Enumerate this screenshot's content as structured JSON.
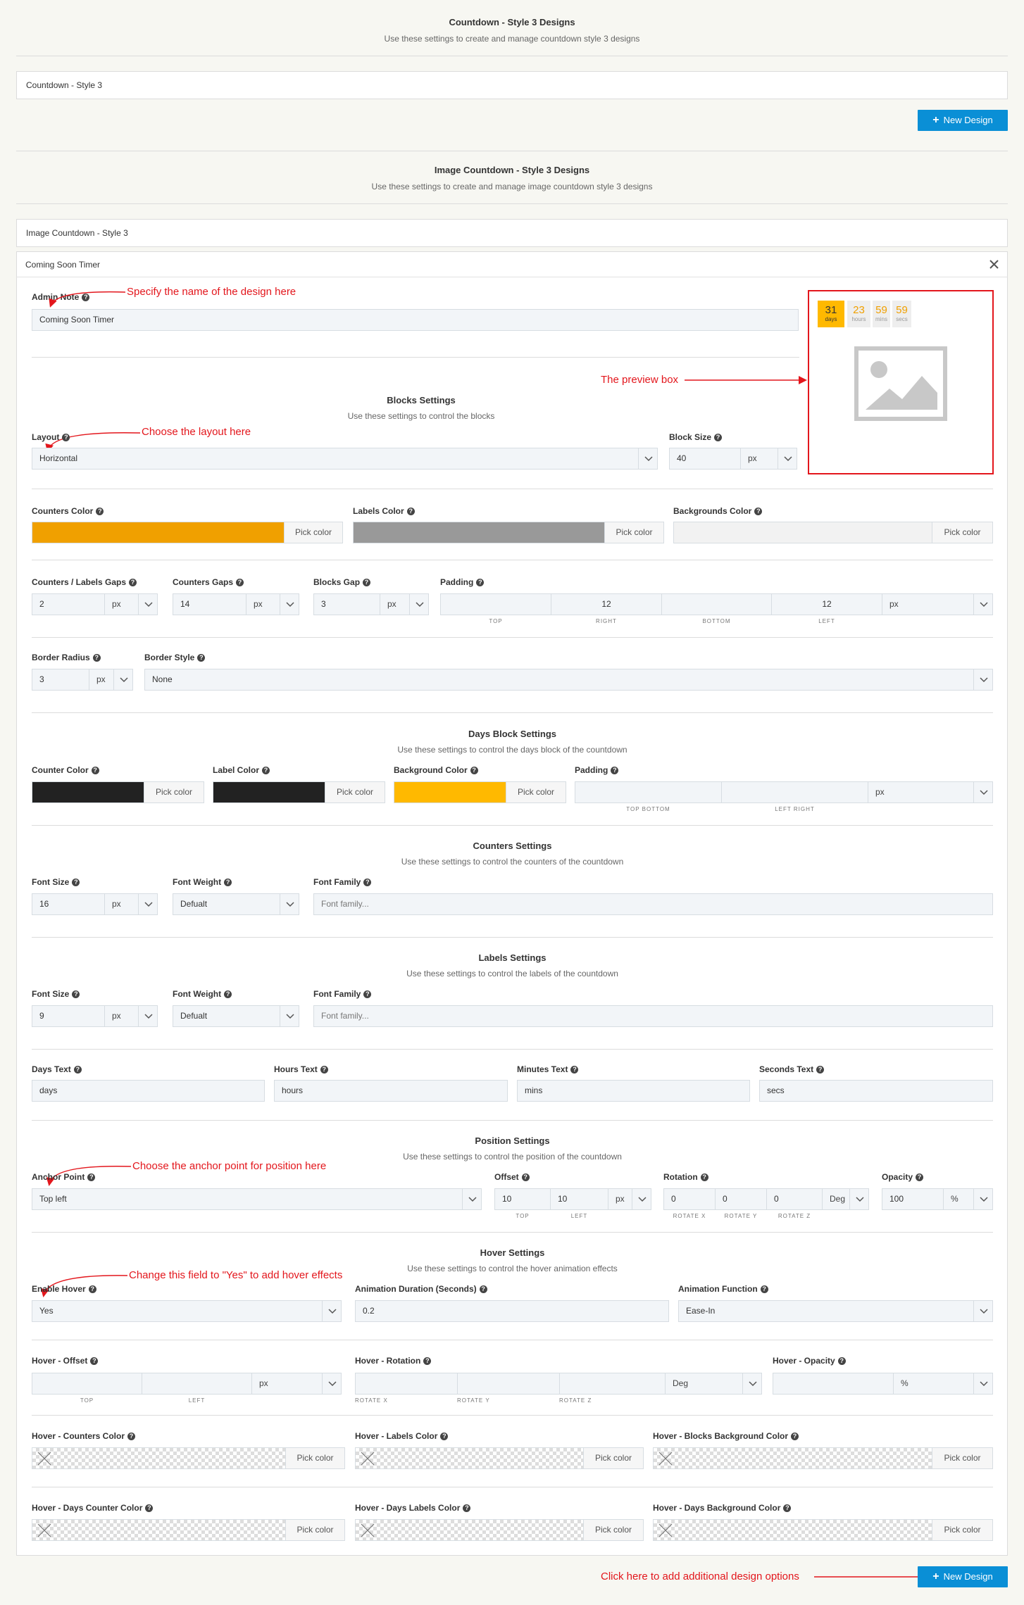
{
  "section1": {
    "title": "Countdown - Style 3 Designs",
    "desc": "Use these settings to create and manage countdown style 3 designs",
    "item": "Countdown - Style 3",
    "new_btn": "New Design"
  },
  "section2": {
    "title": "Image Countdown - Style 3 Designs",
    "desc": "Use these settings to create and manage image countdown style 3 designs",
    "item": "Image Countdown - Style 3"
  },
  "design": {
    "header": "Coming Soon Timer",
    "admin_note_label": "Admin Note",
    "admin_note_value": "Coming Soon Timer"
  },
  "preview": {
    "days": "31",
    "days_lbl": "days",
    "hours": "23",
    "hours_lbl": "hours",
    "mins": "59",
    "mins_lbl": "mins",
    "secs": "59",
    "secs_lbl": "secs"
  },
  "annotations": {
    "name": "Specify the name of the design here",
    "preview": "The preview box",
    "layout": "Choose the layout here",
    "anchor": "Choose the anchor point for position here",
    "hover": "Change this field to \"Yes\" to add hover effects",
    "new_design": "Click here to add additional design options"
  },
  "blocks": {
    "title": "Blocks Settings",
    "desc": "Use these settings to control the blocks",
    "layout_label": "Layout",
    "layout_value": "Horizontal",
    "block_size_label": "Block Size",
    "block_size_value": "40",
    "block_size_unit": "px",
    "counters_color_label": "Counters Color",
    "labels_color_label": "Labels Color",
    "backgrounds_color_label": "Backgrounds Color",
    "pick": "Pick color",
    "cl_gaps_label": "Counters / Labels Gaps",
    "cl_gaps_value": "2",
    "counters_gaps_label": "Counters Gaps",
    "counters_gaps_value": "14",
    "blocks_gap_label": "Blocks Gap",
    "blocks_gap_value": "3",
    "padding_label": "Padding",
    "padding_right": "12",
    "padding_left": "12",
    "sub_top": "TOP",
    "sub_right": "RIGHT",
    "sub_bottom": "BOTTOM",
    "sub_left": "LEFT",
    "border_radius_label": "Border Radius",
    "border_radius_value": "3",
    "border_style_label": "Border Style",
    "border_style_value": "None",
    "unit_px": "px"
  },
  "days": {
    "title": "Days Block Settings",
    "desc": "Use these settings to control the days block of the countdown",
    "counter_color_label": "Counter Color",
    "label_color_label": "Label Color",
    "bg_color_label": "Background Color",
    "padding_label": "Padding",
    "sub_tb": "TOP BOTTOM",
    "sub_lr": "LEFT RIGHT"
  },
  "counters": {
    "title": "Counters Settings",
    "desc": "Use these settings to control the counters of the countdown",
    "font_size_label": "Font Size",
    "font_size_value": "16",
    "font_weight_label": "Font Weight",
    "font_weight_value": "Defualt",
    "font_family_label": "Font Family",
    "font_family_ph": "Font family..."
  },
  "labels": {
    "title": "Labels Settings",
    "desc": "Use these settings to control the labels of the countdown",
    "font_size_value": "9",
    "days_text_label": "Days Text",
    "days_text_value": "days",
    "hours_text_label": "Hours Text",
    "hours_text_value": "hours",
    "minutes_text_label": "Minutes Text",
    "minutes_text_value": "mins",
    "seconds_text_label": "Seconds Text",
    "seconds_text_value": "secs"
  },
  "position": {
    "title": "Position Settings",
    "desc": "Use these settings to control the position of the countdown",
    "anchor_label": "Anchor Point",
    "anchor_value": "Top left",
    "offset_label": "Offset",
    "offset_top": "10",
    "offset_left": "10",
    "rotation_label": "Rotation",
    "rot_x": "0",
    "rot_y": "0",
    "rot_z": "0",
    "unit_deg": "Deg",
    "opacity_label": "Opacity",
    "opacity_value": "100",
    "unit_pct": "%",
    "sub_rx": "ROTATE X",
    "sub_ry": "ROTATE Y",
    "sub_rz": "ROTATE Z"
  },
  "hover": {
    "title": "Hover Settings",
    "desc": "Use these settings to control the hover animation effects",
    "enable_label": "Enable Hover",
    "enable_value": "Yes",
    "duration_label": "Animation Duration (Seconds)",
    "duration_value": "0.2",
    "function_label": "Animation Function",
    "function_value": "Ease-In",
    "offset_label": "Hover - Offset",
    "rotation_label": "Hover - Rotation",
    "opacity_label": "Hover - Opacity",
    "counters_color_label": "Hover - Counters Color",
    "labels_color_label": "Hover - Labels Color",
    "blocks_bg_label": "Hover - Blocks Background Color",
    "days_counter_label": "Hover - Days Counter Color",
    "days_labels_label": "Hover - Days Labels Color",
    "days_bg_label": "Hover - Days Background Color"
  },
  "colors": {
    "orange": "#f0a000",
    "gray": "#999999",
    "black": "#222222",
    "gold": "#ffb900",
    "accent": "#0a8fd6",
    "annotation": "#e3161c"
  }
}
